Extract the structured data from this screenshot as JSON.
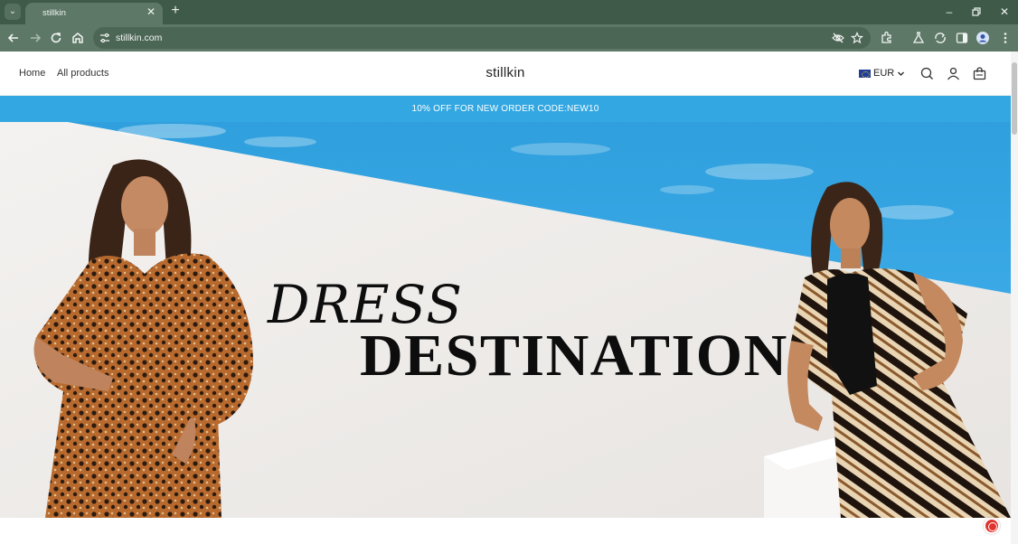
{
  "browser": {
    "tab_title": "stillkin",
    "url": "stillkin.com"
  },
  "header": {
    "nav": [
      "Home",
      "All products"
    ],
    "brand": "stillkin",
    "currency": "EUR"
  },
  "announcement": "10% OFF FOR NEW ORDER CODE:NEW10",
  "hero": {
    "headline_line1": "DRESS",
    "headline_line2": "DESTINATION"
  },
  "colors": {
    "chrome_dark": "#3f5a49",
    "chrome": "#5d7866",
    "accent_blue": "#33a7e1",
    "hero_wall": "#f0eeec"
  },
  "icons": [
    "tab-list-icon",
    "close-tab-icon",
    "new-tab-icon",
    "minimize-icon",
    "restore-icon",
    "close-window-icon",
    "back-icon",
    "forward-icon",
    "reload-icon",
    "home-icon",
    "site-settings-icon",
    "eye-off-icon",
    "star-icon",
    "extensions-icon",
    "labs-icon",
    "sync-icon",
    "side-panel-icon",
    "profile-icon",
    "menu-icon",
    "search-icon",
    "account-icon",
    "cart-icon",
    "chat-icon"
  ]
}
